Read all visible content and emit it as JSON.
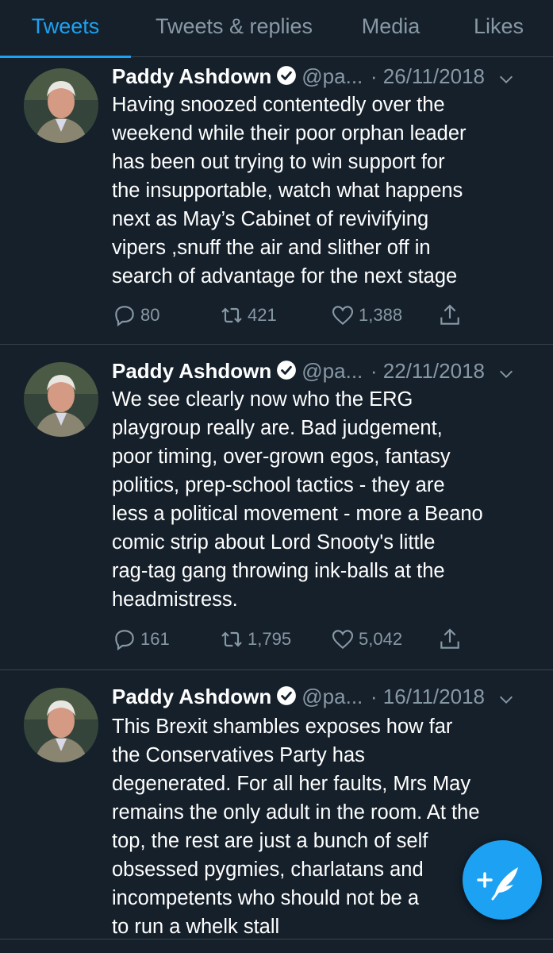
{
  "tabs": [
    {
      "label": "Tweets",
      "active": true
    },
    {
      "label": "Tweets & replies",
      "active": false
    },
    {
      "label": "Media",
      "active": false
    },
    {
      "label": "Likes",
      "active": false
    }
  ],
  "tweets": [
    {
      "name": "Paddy Ashdown",
      "handle": "@pa...",
      "date": "· 26/11/2018",
      "lines": [
        "Having snoozed contentedly over the",
        "weekend while their poor orphan leader",
        "has been out trying to win support for",
        "the insupportable, watch what happens",
        "next as May’s Cabinet of revivifying",
        "vipers ,snuff the air and slither off in",
        "search of advantage for the next stage"
      ],
      "replies": "80",
      "retweets": "421",
      "likes": "1,388"
    },
    {
      "name": "Paddy Ashdown",
      "handle": "@pa...",
      "date": "· 22/11/2018",
      "lines": [
        "We see clearly now who the ERG",
        "playgroup really are. Bad judgement,",
        "poor timing, over-grown egos, fantasy",
        "politics, prep-school tactics - they are",
        "less a political movement - more a Beano",
        "comic strip about Lord Snooty's little",
        "rag-tag gang throwing ink-balls at the",
        "headmistress."
      ],
      "replies": "161",
      "retweets": "1,795",
      "likes": "5,042"
    },
    {
      "name": "Paddy Ashdown",
      "handle": "@pa...",
      "date": "· 16/11/2018",
      "lines": [
        "This Brexit shambles exposes how far",
        "the Conservatives Party has",
        "degenerated. For all her faults, Mrs May",
        "remains the only adult in the room. At the",
        "top, the rest are just a bunch of self",
        "obsessed pygmies, charlatans and",
        "incompetents who should not be a",
        "to run a whelk stall"
      ]
    }
  ],
  "colors": {
    "background": "#15202b",
    "accent": "#1da1f2",
    "secondary_text": "#8899a6",
    "divider": "#38444d"
  },
  "icons": {
    "compose": "feather-plus-icon",
    "verified": "verified-badge-icon",
    "caret": "chevron-down-icon",
    "reply": "reply-icon",
    "retweet": "retweet-icon",
    "like": "heart-icon",
    "share": "share-icon"
  }
}
